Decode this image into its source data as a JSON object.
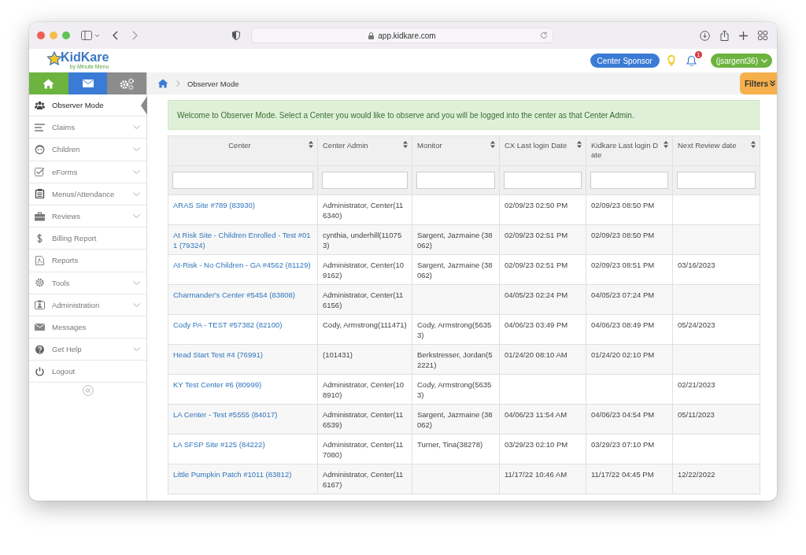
{
  "browser": {
    "url": "app.kidkare.com"
  },
  "header": {
    "logo": "KidKare",
    "logo_tagline": "by Minute Menu",
    "sponsor_button": "Center Sponsor",
    "notification_count": "1",
    "user_menu": "(jsargent36)"
  },
  "breadcrumb": {
    "current": "Observer Mode"
  },
  "filters_button": "Filters",
  "sidebar": {
    "items": [
      {
        "label": "Observer Mode",
        "has_submenu": false,
        "selected": true
      },
      {
        "label": "Claims",
        "has_submenu": true,
        "selected": false
      },
      {
        "label": "Children",
        "has_submenu": true,
        "selected": false
      },
      {
        "label": "eForms",
        "has_submenu": true,
        "selected": false
      },
      {
        "label": "Menus/Attendance",
        "has_submenu": true,
        "selected": false
      },
      {
        "label": "Reviews",
        "has_submenu": true,
        "selected": false
      },
      {
        "label": "Billing Report",
        "has_submenu": false,
        "selected": false
      },
      {
        "label": "Reports",
        "has_submenu": false,
        "selected": false
      },
      {
        "label": "Tools",
        "has_submenu": true,
        "selected": false
      },
      {
        "label": "Administration",
        "has_submenu": true,
        "selected": false
      },
      {
        "label": "Messages",
        "has_submenu": false,
        "selected": false
      },
      {
        "label": "Get Help",
        "has_submenu": true,
        "selected": false
      },
      {
        "label": "Logout",
        "has_submenu": false,
        "selected": false
      }
    ]
  },
  "alert": "Welcome to Observer Mode. Select a Center you would like to observe and you will be logged into the center as that Center Admin.",
  "table": {
    "columns": [
      "Center",
      "Center Admin",
      "Monitor",
      "CX Last login Date",
      "Kidkare Last login Date",
      "Next Review date"
    ],
    "rows": [
      {
        "center": "ARAS Site #789 (83930)",
        "center_admin": "Administrator, Center(116340)",
        "cx_last_login": "02/09/23 02:50 PM",
        "kidkare_last_login": "02/09/23 08:50 PM"
      },
      {
        "center": "At Risk Site - Children Enrolled - Test #011 (79324)",
        "center_admin": "cynthia, underhill(110753)",
        "monitor": "Sargent, Jazmaine (38062)",
        "cx_last_login": "02/09/23 02:51 PM",
        "kidkare_last_login": "02/09/23 08:50 PM"
      },
      {
        "center": "At-Risk - No Children - GA #4562 (81129)",
        "center_admin": "Administrator, Center(109162)",
        "monitor": "Sargent, Jazmaine (38062)",
        "cx_last_login": "02/09/23 02:51 PM",
        "kidkare_last_login": "02/09/23 08:51 PM",
        "next_review": "03/16/2023"
      },
      {
        "center": "Charmander's Center #5454 (83808)",
        "center_admin": "Administrator, Center(116156)",
        "cx_last_login": "04/05/23 02:24 PM",
        "kidkare_last_login": "04/05/23 07:24 PM"
      },
      {
        "center": "Cody PA - TEST #57382 (82100)",
        "center_admin": "Cody, Armstrong(111471)",
        "monitor": "Cody, Armstrong(56353)",
        "cx_last_login": "04/06/23 03:49 PM",
        "kidkare_last_login": "04/06/23 08:49 PM",
        "next_review": "05/24/2023"
      },
      {
        "center": "Head Start Test #4 (76991)",
        "center_admin": "(101431)",
        "monitor": "Berkstresser, Jordan(52221)",
        "cx_last_login": "01/24/20 08:10 AM",
        "kidkare_last_login": "01/24/20 02:10 PM"
      },
      {
        "center": "KY Test Center #6 (80999)",
        "center_admin": "Administrator, Center(108910)",
        "monitor": "Cody, Armstrong(56353)",
        "next_review": "02/21/2023"
      },
      {
        "center": "LA Center - Test #5555 (84017)",
        "center_admin": "Administrator, Center(116539)",
        "monitor": "Sargent, Jazmaine (38062)",
        "cx_last_login": "04/06/23 11:54 AM",
        "kidkare_last_login": "04/06/23 04:54 PM",
        "next_review": "05/11/2023"
      },
      {
        "center": "LA SFSP Site #125 (84222)",
        "center_admin": "Administrator, Center(117080)",
        "monitor": "Turner, Tina(38278)",
        "cx_last_login": "03/29/23 02:10 PM",
        "kidkare_last_login": "03/29/23 07:10 PM"
      },
      {
        "center": "Little Pumpkin Patch #1011 (83812)",
        "center_admin": "Administrator, Center(116167)",
        "cx_last_login": "11/17/22 10:46 AM",
        "kidkare_last_login": "11/17/22 04:45 PM",
        "next_review": "12/22/2022"
      }
    ]
  }
}
